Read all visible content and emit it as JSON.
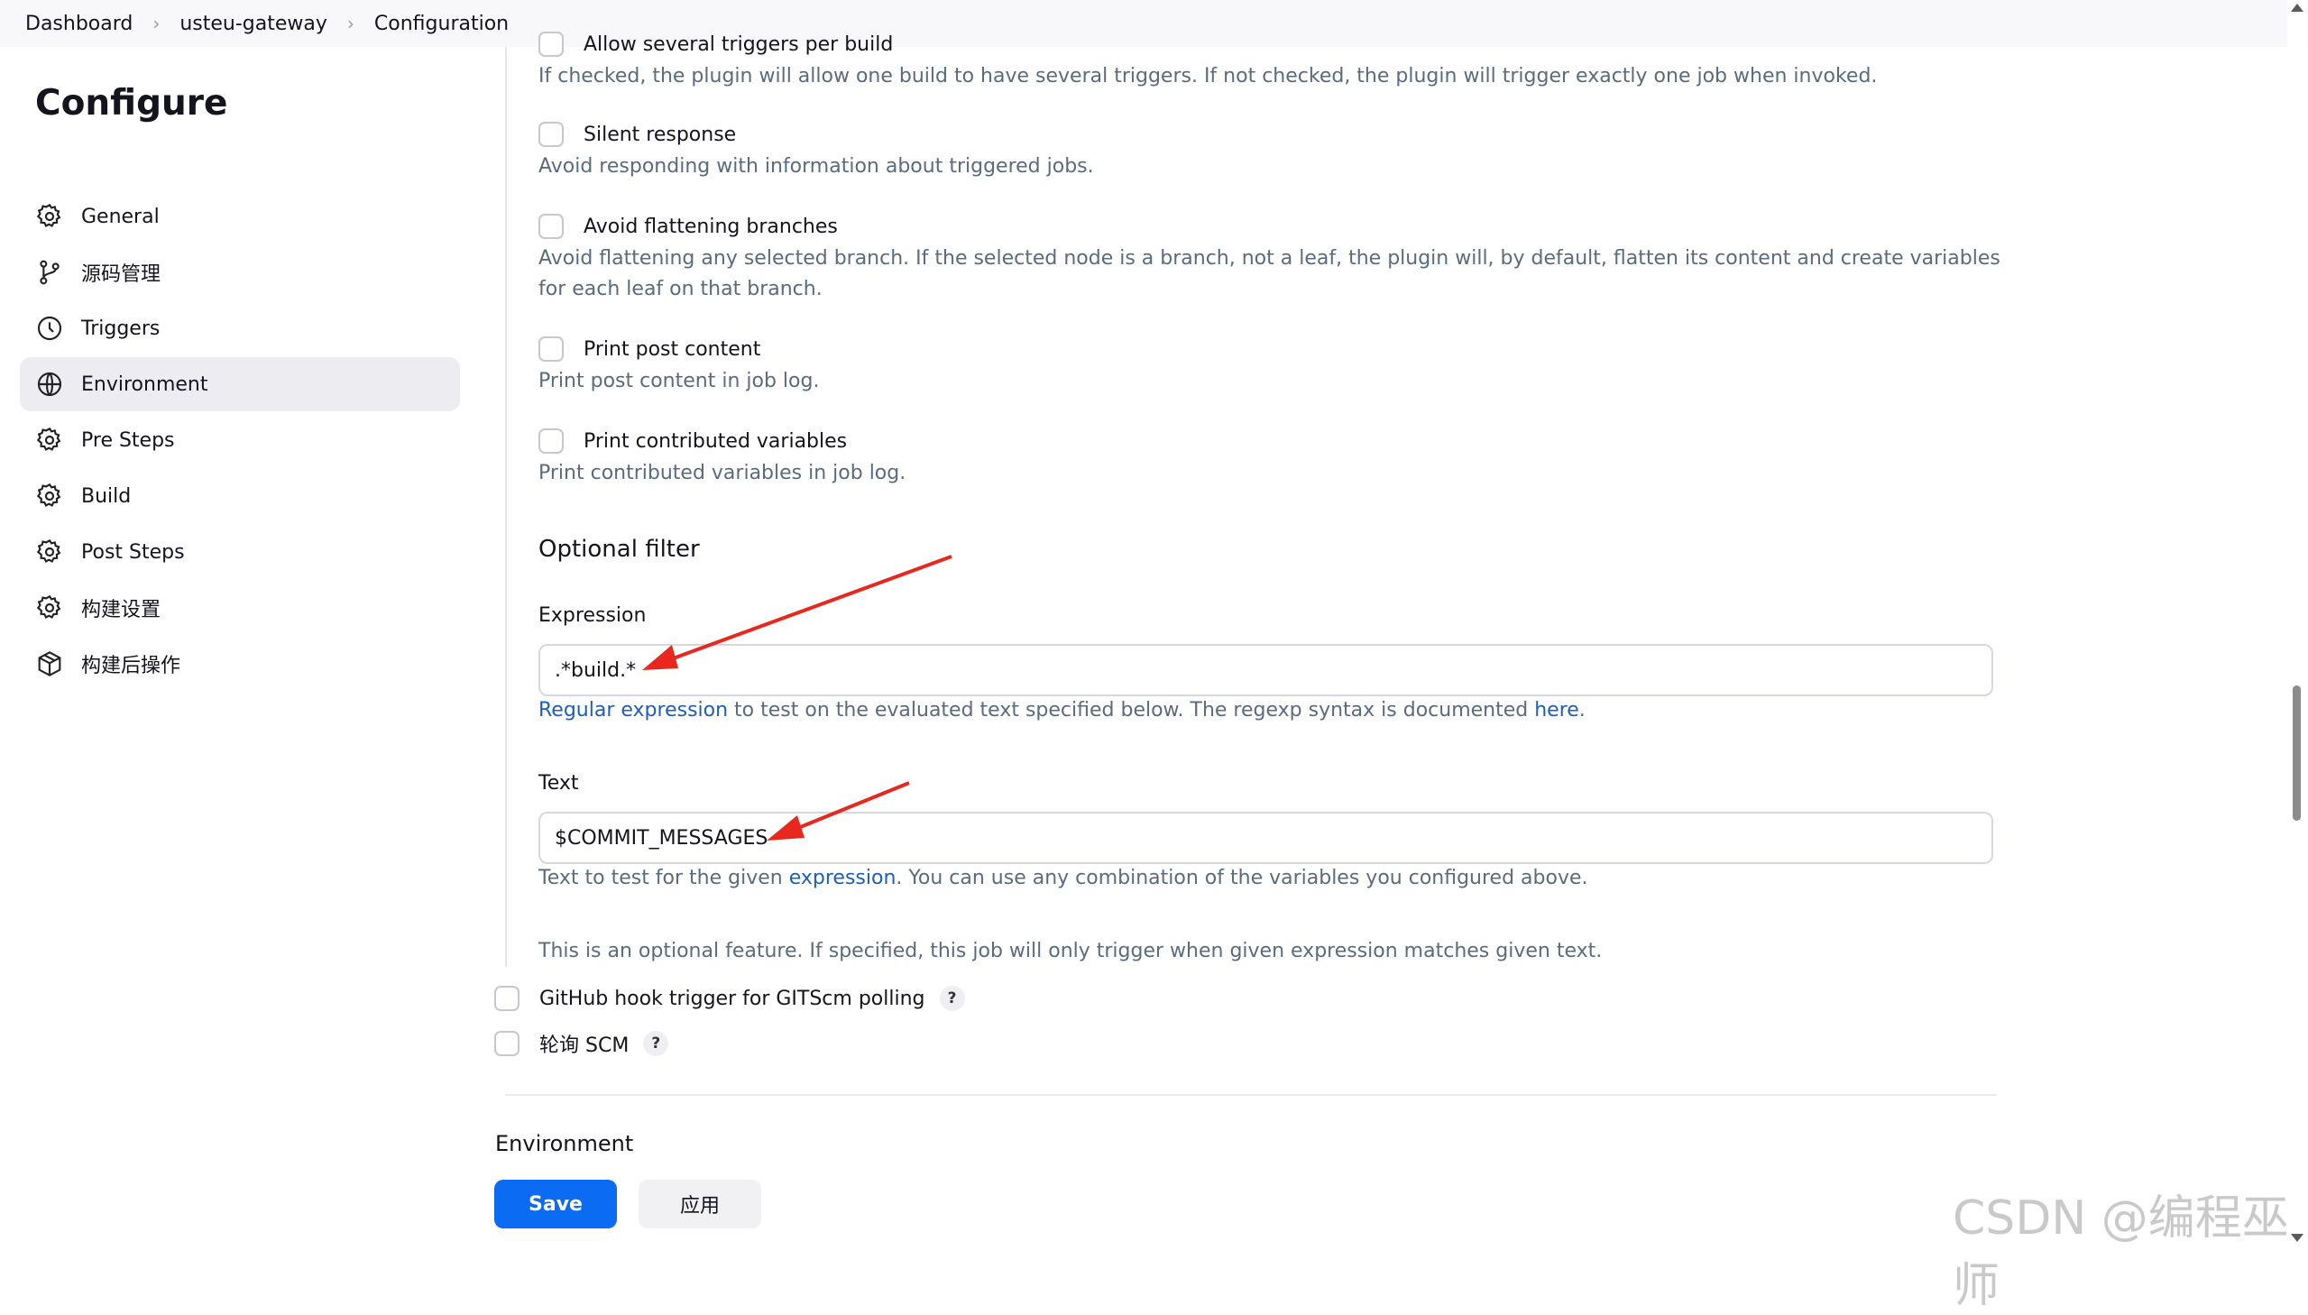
{
  "breadcrumb": [
    "Dashboard",
    "usteu-gateway",
    "Configuration"
  ],
  "sidebar": {
    "title": "Configure",
    "items": [
      {
        "label": "General",
        "icon": "gear-icon"
      },
      {
        "label": "源码管理",
        "icon": "branch-icon"
      },
      {
        "label": "Triggers",
        "icon": "clock-icon"
      },
      {
        "label": "Environment",
        "icon": "globe-icon",
        "active": true
      },
      {
        "label": "Pre Steps",
        "icon": "gear-icon"
      },
      {
        "label": "Build",
        "icon": "gear-icon"
      },
      {
        "label": "Post Steps",
        "icon": "gear-icon"
      },
      {
        "label": "构建设置",
        "icon": "gear-icon"
      },
      {
        "label": "构建后操作",
        "icon": "package-icon"
      }
    ]
  },
  "options": [
    {
      "label": "Allow several triggers per build",
      "desc": "If checked, the plugin will allow one build to have several triggers. If not checked, the plugin will trigger exactly one job when invoked."
    },
    {
      "label": "Silent response",
      "desc": "Avoid responding with information about triggered jobs."
    },
    {
      "label": "Avoid flattening branches",
      "desc": "Avoid flattening any selected branch. If the selected node is a branch, not a leaf, the plugin will, by default, flatten its content and create variables for each leaf on that branch."
    },
    {
      "label": "Print post content",
      "desc": "Print post content in job log."
    },
    {
      "label": "Print contributed variables",
      "desc": "Print contributed variables in job log."
    }
  ],
  "filter": {
    "title": "Optional filter",
    "expression_label": "Expression",
    "expression_value": ".*build.*",
    "expression_help_link1": "Regular expression",
    "expression_help_mid": " to test on the evaluated text specified below. The regexp syntax is documented ",
    "expression_help_link2": "here",
    "expression_help_end": ".",
    "text_label": "Text",
    "text_value": "$COMMIT_MESSAGES",
    "text_help_pre": "Text to test for the given ",
    "text_help_link": "expression",
    "text_help_post": ". You can use any combination of the variables you configured above.",
    "note": "This is an optional feature. If specified, this job will only trigger when given expression matches given text."
  },
  "triggers": [
    {
      "label": "GitHub hook trigger for GITScm polling",
      "help": "?"
    },
    {
      "label": "轮询 SCM",
      "help": "?"
    }
  ],
  "environment_heading": "Environment",
  "buttons": {
    "save": "Save",
    "apply": "应用"
  },
  "watermark": "CSDN @编程巫师",
  "colors": {
    "accent": "#0b6bf2",
    "link": "#1d5fb8",
    "annotation_arrow": "#e8281f"
  }
}
